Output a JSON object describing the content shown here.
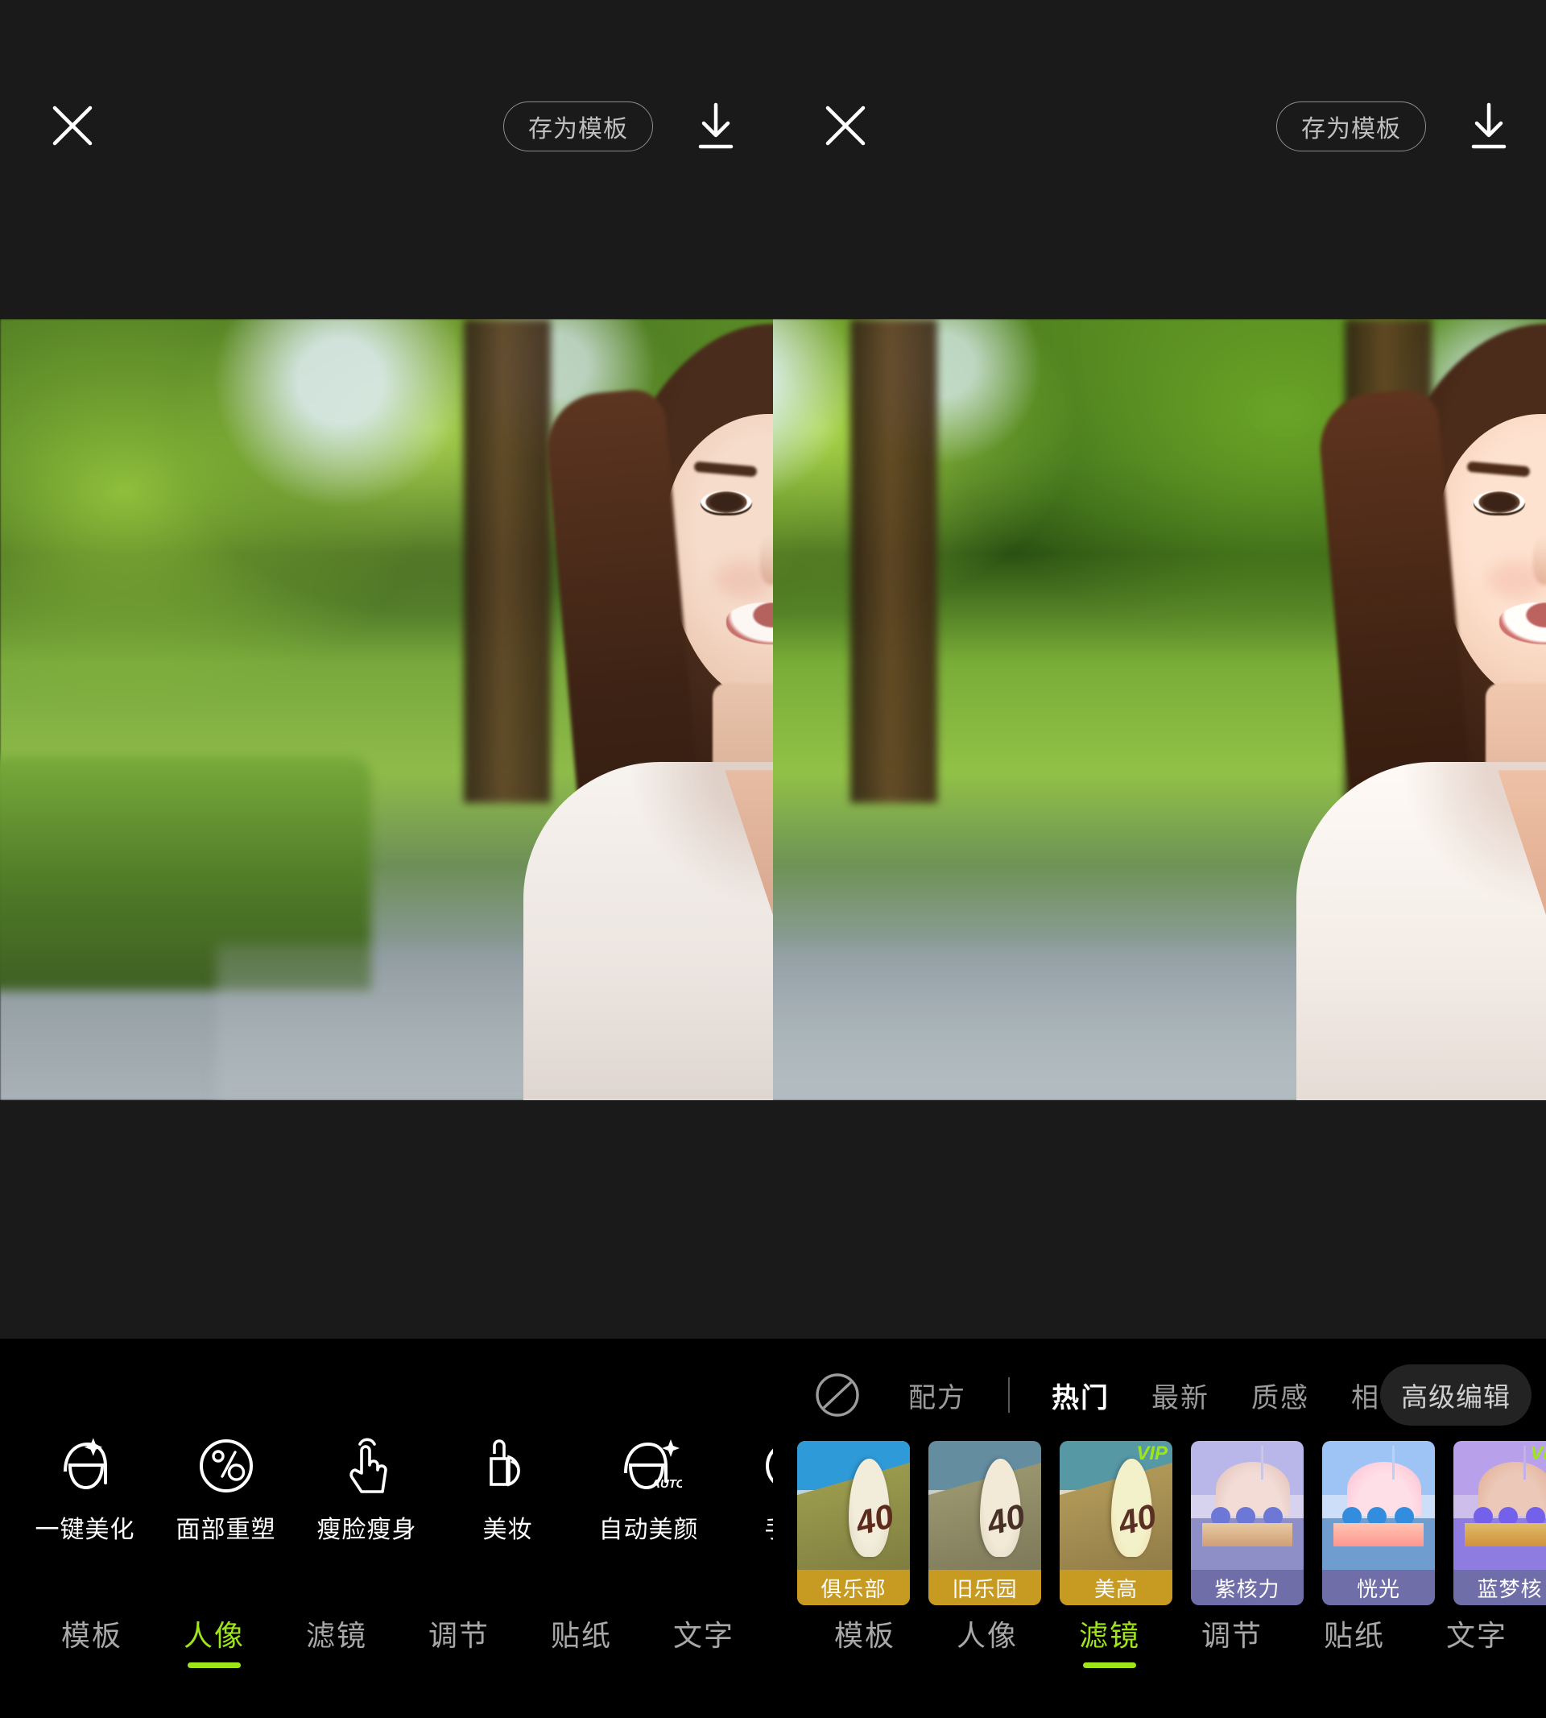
{
  "app": {
    "background": "#1a1a1a",
    "toolbar_background": "#000000",
    "accent_lime": "#9FE618",
    "amber": "#C79A22",
    "purple": "#6F6EA8"
  },
  "panels": [
    {
      "id": "left-panel",
      "topbar": {
        "close_icon": "close-icon",
        "save_template_label": "存为模板",
        "download_icon": "download-icon"
      },
      "tool_row": {
        "items": [
          {
            "label": "一键美化",
            "icon": "face-sparkle-icon"
          },
          {
            "label": "面部重塑",
            "icon": "face-percent-circle-icon"
          },
          {
            "label": "瘦脸瘦身",
            "icon": "pointing-hand-icon"
          },
          {
            "label": "美妆",
            "icon": "lipstick-icon"
          },
          {
            "label": "自动美颜",
            "icon": "face-auto-icon"
          },
          {
            "label": "手动",
            "icon": "manual-icon"
          }
        ]
      },
      "nav": {
        "items": [
          "模板",
          "人像",
          "滤镜",
          "调节",
          "贴纸",
          "文字"
        ],
        "active": "人像"
      }
    },
    {
      "id": "right-panel",
      "topbar": {
        "close_icon": "close-icon",
        "save_template_label": "存为模板",
        "download_icon": "download-icon"
      },
      "filter_tabs": {
        "no_filter_icon": "no-filter-circle-slash-icon",
        "recipe_label": "配方",
        "categories": [
          "热门",
          "最新",
          "质感",
          "相机"
        ],
        "active": "热门",
        "advanced_edit_label": "高级编辑"
      },
      "filters": [
        {
          "name": "俱乐部",
          "vip": false,
          "selected": true,
          "art": "bowling",
          "variant": "club",
          "badge": "",
          "cap_color": "#C79A22",
          "thumb_number": "40"
        },
        {
          "name": "旧乐园",
          "vip": false,
          "selected": false,
          "art": "bowling",
          "variant": "old",
          "badge": "",
          "cap_color": "#C79A22",
          "thumb_number": "40"
        },
        {
          "name": "美高",
          "vip": true,
          "selected": false,
          "art": "bowling",
          "variant": "vipA",
          "badge": "VIP",
          "cap_color": "#C79A22",
          "thumb_number": "40"
        },
        {
          "name": "紫核力",
          "vip": false,
          "selected": false,
          "art": "carousel",
          "variant": "pu",
          "badge": "",
          "cap_color": "#6F6EA8",
          "thumb_number": ""
        },
        {
          "name": "恍光",
          "vip": false,
          "selected": false,
          "art": "carousel",
          "variant": "cy",
          "badge": "",
          "cap_color": "#6F6EA8",
          "thumb_number": ""
        },
        {
          "name": "蓝梦核",
          "vip": true,
          "selected": false,
          "art": "carousel",
          "variant": "bl",
          "badge": "VIP",
          "cap_color": "#6F6EA8",
          "thumb_number": ""
        }
      ],
      "nav": {
        "items": [
          "模板",
          "人像",
          "滤镜",
          "调节",
          "贴纸",
          "文字"
        ],
        "active": "滤镜"
      }
    }
  ],
  "photo": {
    "description": "portrait of smiling young woman with long brown hair in white v-neck top, blurred sunlit park with green hedges"
  }
}
